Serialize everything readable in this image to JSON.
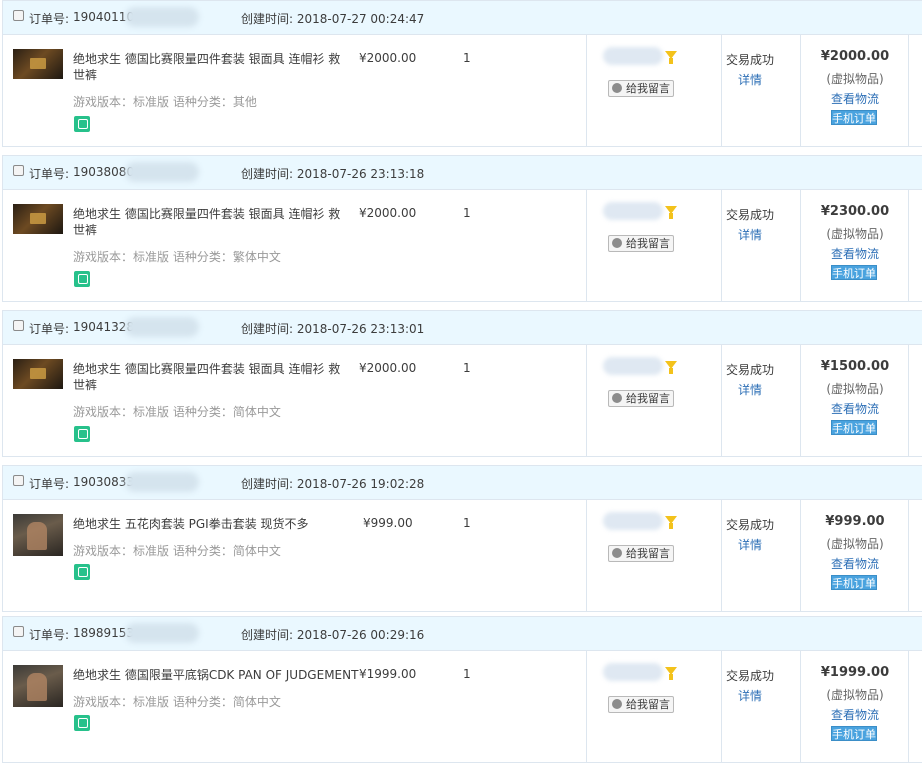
{
  "labels": {
    "order_no": "订单号:",
    "created": "创建时间:",
    "leave_message": "给我留言",
    "detail": "详情",
    "view_logistics": "查看物流",
    "mobile_order": "手机订单",
    "virtual_item": "(虚拟物品)"
  },
  "colors": {
    "header_bg": "#eaf8ff",
    "link": "#2d6fb6",
    "mobile_badge": "#4aa3df",
    "funnel": "#f3c21b",
    "mobile_icon": "#27c18b"
  },
  "orders": [
    {
      "order_no": "19040110",
      "created_time": "创建时间: 2018-07-27 00:24:47",
      "product_name": "绝地求生 德国比赛限量四件套装 银面具 连帽衫 救世裤",
      "meta": "游戏版本：标准版 语种分类：其他",
      "unit_price": "¥2000.00",
      "quantity": "1",
      "status": "交易成功",
      "total": "¥2000.00"
    },
    {
      "order_no": "19038080",
      "created_time": "创建时间: 2018-07-26 23:13:18",
      "product_name": "绝地求生 德国比赛限量四件套装 银面具 连帽衫 救世裤",
      "meta": "游戏版本：标准版 语种分类：繁体中文",
      "unit_price": "¥2000.00",
      "quantity": "1",
      "status": "交易成功",
      "total": "¥2300.00"
    },
    {
      "order_no": "19041328",
      "created_time": "创建时间: 2018-07-26 23:13:01",
      "product_name": "绝地求生 德国比赛限量四件套装 银面具 连帽衫 救世裤",
      "meta": "游戏版本：标准版 语种分类：简体中文",
      "unit_price": "¥2000.00",
      "quantity": "1",
      "status": "交易成功",
      "total": "¥1500.00"
    },
    {
      "order_no": "19030833",
      "created_time": "创建时间: 2018-07-26 19:02:28",
      "product_name": "绝地求生 五花肉套装 PGI拳击套装 现货不多",
      "meta": "游戏版本：标准版 语种分类：简体中文",
      "unit_price": "¥999.00",
      "quantity": "1",
      "status": "交易成功",
      "total": "¥999.00"
    },
    {
      "order_no": "18989153",
      "created_time": "创建时间: 2018-07-26 00:29:16",
      "product_name": "绝地求生 德国限量平底锅CDK PAN OF JUDGEMENT",
      "meta": "游戏版本：标准版 语种分类：简体中文",
      "unit_price": "¥1999.00",
      "quantity": "1",
      "status": "交易成功",
      "total": "¥1999.00"
    }
  ]
}
